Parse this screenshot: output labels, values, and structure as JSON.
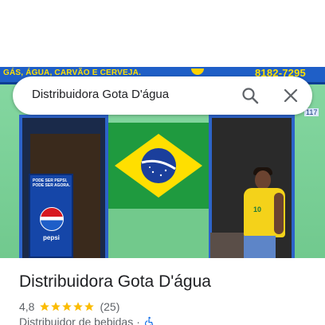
{
  "photo": {
    "sign_left_text": "GÁS, ÁGUA, CARVÃO E CERVEJA.",
    "sign_phone": "8182-7295",
    "house_number": "117",
    "fridge_text": "PODE SER PEPSI. PODE SER AGORA.",
    "fridge_brand": "pepsi",
    "shirt_number": "10"
  },
  "search": {
    "query": "Distribuidora Gota D'água",
    "search_icon": "search-icon",
    "close_icon": "close-icon"
  },
  "place": {
    "title": "Distribuidora Gota D'água",
    "rating": "4,8",
    "stars": 5,
    "review_count": "(25)",
    "category": "Distribuidor de bebidas",
    "separator": "·",
    "accessibility_icon": "wheelchair-icon"
  },
  "colors": {
    "star": "#fbbc04",
    "title_text": "#202124",
    "secondary_text": "#5f6368",
    "accessibility_blue": "#1a73e8"
  }
}
